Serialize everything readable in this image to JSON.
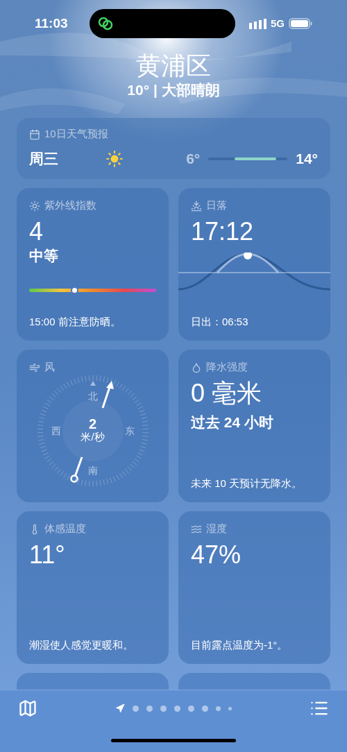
{
  "status_bar": {
    "time": "11:03",
    "network": "5G"
  },
  "header": {
    "location": "黄浦区",
    "summary": "10° | 大部晴朗"
  },
  "forecast": {
    "title": "10日天气预报",
    "rows": [
      {
        "day": "周三",
        "low": "6°",
        "high": "14°"
      }
    ]
  },
  "cards": [
    {
      "kind": "uv",
      "title": "紫外线指数",
      "value": "4",
      "label": "中等",
      "level": 0.36,
      "note": "15:00 前注意防晒。"
    },
    {
      "kind": "sunset",
      "title": "日落",
      "value": "17:12",
      "note": "日出：06:53"
    },
    {
      "kind": "wind",
      "title": "风",
      "directions": [
        "北",
        "东",
        "南",
        "西"
      ],
      "speed": "2",
      "unit": "米/秒"
    },
    {
      "kind": "precip",
      "title": "降水强度",
      "value": "0 毫米",
      "label": "过去 24 小时",
      "note": "未来 10 天预计无降水。"
    },
    {
      "kind": "feels",
      "title": "体感温度",
      "value": "11°",
      "note": "潮湿使人感觉更暖和。"
    },
    {
      "kind": "humidity",
      "title": "湿度",
      "value": "47%",
      "note": "目前露点温度为-1°。"
    },
    {
      "kind": "partial"
    },
    {
      "kind": "partial"
    }
  ],
  "page_dots": [
    {
      "kind": "location",
      "selected": true
    },
    {
      "kind": "dot",
      "selected": false
    },
    {
      "kind": "dot",
      "selected": false
    },
    {
      "kind": "dot",
      "selected": false
    },
    {
      "kind": "dot",
      "selected": false
    },
    {
      "kind": "dot",
      "selected": false
    },
    {
      "kind": "dot",
      "selected": false
    },
    {
      "kind": "small",
      "selected": false
    },
    {
      "kind": "tiny",
      "selected": false
    }
  ]
}
